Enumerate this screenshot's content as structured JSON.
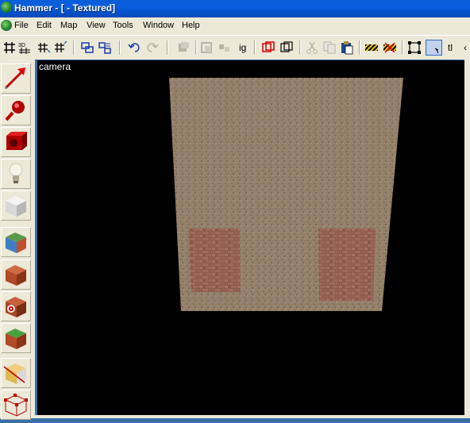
{
  "window": {
    "title": "Hammer - [ - Textured]"
  },
  "menu": {
    "items": [
      "File",
      "Edit",
      "Map",
      "View",
      "Tools",
      "Window",
      "Help"
    ]
  },
  "toolbar": {
    "text_ig": "ig",
    "text_tl": "tl",
    "text_overflow": "‹"
  },
  "viewport": {
    "label": "camera"
  },
  "sidebar": {
    "tools": [
      "selection-tool",
      "magnify-tool",
      "camera-tool",
      "entity-tool",
      "block-tool",
      "texture-application-tool",
      "apply-current-texture-tool",
      "decal-tool",
      "overlay-tool",
      "clipping-tool",
      "vertex-tool"
    ]
  },
  "colors": {
    "title_blue": "#0a5fd8",
    "face": "#ece9d8",
    "viewport_bg": "#000000"
  }
}
